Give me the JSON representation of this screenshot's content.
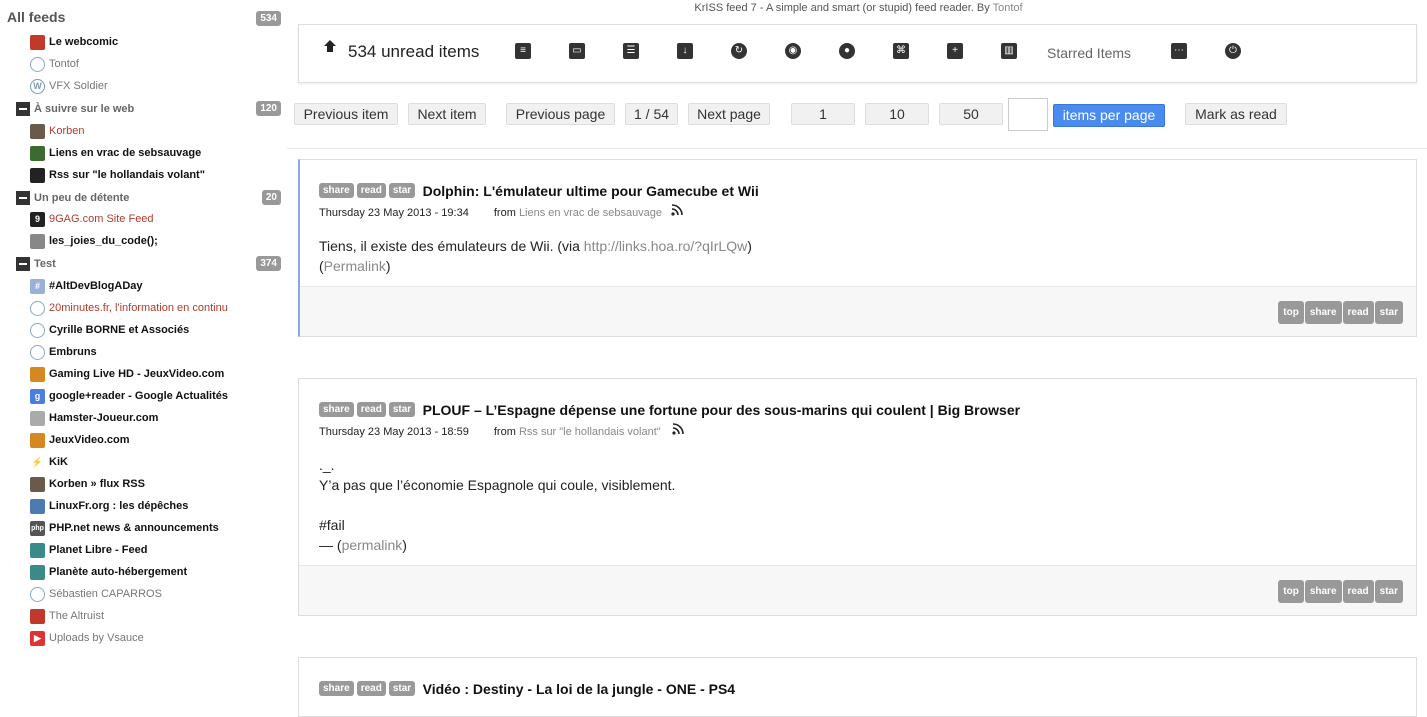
{
  "sidebar": {
    "all_feeds_label": "All feeds",
    "all_feeds_count": "534",
    "feeds_top": [
      {
        "name": "Le webcomic",
        "style": "bold",
        "icon": "webcomic-icon",
        "color": "#c0392b"
      },
      {
        "name": "Tontof",
        "style": "read",
        "icon": "globe-icon",
        "color": "#8aa7c9"
      },
      {
        "name": "VFX Soldier",
        "style": "read",
        "icon": "wordpress-icon",
        "color": "#7a9ab8"
      }
    ],
    "folders": [
      {
        "name": "À suivre sur le web",
        "count": "120",
        "feeds": [
          {
            "name": "Korben",
            "style": "red",
            "icon": "korben-icon",
            "color": "#6b5a4a"
          },
          {
            "name": "Liens en vrac de sebsauvage",
            "style": "bold",
            "icon": "sebsauvage-icon",
            "color": "#3d6b2f"
          },
          {
            "name": "Rss sur \"le hollandais volant\"",
            "style": "bold",
            "icon": "hollandais-icon",
            "color": "#222"
          }
        ]
      },
      {
        "name": "Un peu de détente",
        "count": "20",
        "feeds": [
          {
            "name": "9GAG.com Site Feed",
            "style": "red",
            "icon": "9gag-icon",
            "color": "#222"
          },
          {
            "name": "les_joies_du_code();",
            "style": "bold",
            "icon": "ghost-icon",
            "color": "#888"
          }
        ]
      },
      {
        "name": "Test",
        "count": "374",
        "feeds": [
          {
            "name": "#AltDevBlogADay",
            "style": "bold",
            "icon": "altdev-icon",
            "color": "#9ab0d8"
          },
          {
            "name": "20minutes.fr, l'information en continu",
            "style": "red",
            "icon": "globe-icon",
            "color": "#8aa7c9"
          },
          {
            "name": "Cyrille BORNE et Associés",
            "style": "bold",
            "icon": "globe-icon",
            "color": "#8aa7c9"
          },
          {
            "name": "Embruns",
            "style": "bold",
            "icon": "globe-icon",
            "color": "#8aa7c9"
          },
          {
            "name": "Gaming Live HD - JeuxVideo.com",
            "style": "bold",
            "icon": "gamepad-icon",
            "color": "#d4881f"
          },
          {
            "name": "google+reader - Google Actualités",
            "style": "bold",
            "icon": "google-icon",
            "color": "#4a7fe0"
          },
          {
            "name": "Hamster-Joueur.com",
            "style": "bold",
            "icon": "hamster-icon",
            "color": "#aaa"
          },
          {
            "name": "JeuxVideo.com",
            "style": "bold",
            "icon": "gamepad-icon",
            "color": "#d4881f"
          },
          {
            "name": "KiK",
            "style": "bold",
            "icon": "bolt-icon",
            "color": "#222"
          },
          {
            "name": "Korben » flux RSS",
            "style": "bold",
            "icon": "korben-icon",
            "color": "#6b5a4a"
          },
          {
            "name": "LinuxFr.org : les dépêches",
            "style": "bold",
            "icon": "linuxfr-icon",
            "color": "#4d7bb0"
          },
          {
            "name": "PHP.net news & announcements",
            "style": "bold",
            "icon": "php-icon",
            "color": "#555"
          },
          {
            "name": "Planet Libre - Feed",
            "style": "bold",
            "icon": "planet-icon",
            "color": "#3a8a8a"
          },
          {
            "name": "Planète auto-hébergement",
            "style": "bold",
            "icon": "planet-icon",
            "color": "#3a8a8a"
          },
          {
            "name": "Sébastien CAPARROS",
            "style": "read",
            "icon": "globe-icon",
            "color": "#8aa7c9"
          },
          {
            "name": "The Altruist",
            "style": "read",
            "icon": "altruist-icon",
            "color": "#c0392b"
          },
          {
            "name": "Uploads by Vsauce",
            "style": "read",
            "icon": "youtube-icon",
            "color": "#d33"
          }
        ]
      }
    ]
  },
  "header": {
    "app_name": "KrISS feed 7",
    "tagline": " - A simple and smart (or stupid) feed reader. By ",
    "author": "Tontof"
  },
  "menubar": {
    "unread_label": "534 unread items",
    "starred_label": "Starred Items",
    "icons": [
      "list-view-icon",
      "expanded-view-icon",
      "list-icon",
      "download-icon",
      "refresh-icon",
      "eye-icon",
      "circle-icon",
      "command-icon",
      "plus-icon",
      "stats-icon",
      "more-icon",
      "power-icon"
    ]
  },
  "pager": {
    "previous_item": "Previous item",
    "next_item": "Next item",
    "previous_page": "Previous page",
    "page_indicator": "1 / 54",
    "next_page": "Next page",
    "per_page_options": [
      "1",
      "10",
      "50"
    ],
    "per_page_value": "",
    "items_per_page": "items per page",
    "mark_as_read": "Mark as read"
  },
  "items": [
    {
      "title": "Dolphin: L'émulateur ultime pour Gamecube et Wii",
      "date": "Thursday 23 May 2013 - 19:34",
      "from_label": "from",
      "source": "Liens en vrac de sebsauvage",
      "body_line1": "Tiens, il existe des émulateurs de Wii.  (via ",
      "body_link": "http://links.hoa.ro/?qIrLQw",
      "body_line1_end": ")",
      "body_line2_open": "(",
      "body_permalink": "Permalink",
      "body_line2_close": ")"
    },
    {
      "title": "PLOUF – L’Espagne dépense une fortune pour des sous-marins qui coulent | Big Browser",
      "date": "Thursday 23 May 2013 - 18:59",
      "from_label": "from",
      "source": "Rss sur \"le hollandais volant\"",
      "body_l1": "._.",
      "body_l2": "Y’a pas que l’économie Espagnole qui coule, visiblement.",
      "body_l3": "#fail",
      "body_l4_prefix": "— (",
      "body_permalink": "permalink",
      "body_l4_suffix": ")"
    },
    {
      "title": "Vidéo : Destiny - La loi de la jungle - ONE - PS4"
    }
  ],
  "item_tags": {
    "share": "share",
    "read": "read",
    "star": "star",
    "top": "top"
  }
}
